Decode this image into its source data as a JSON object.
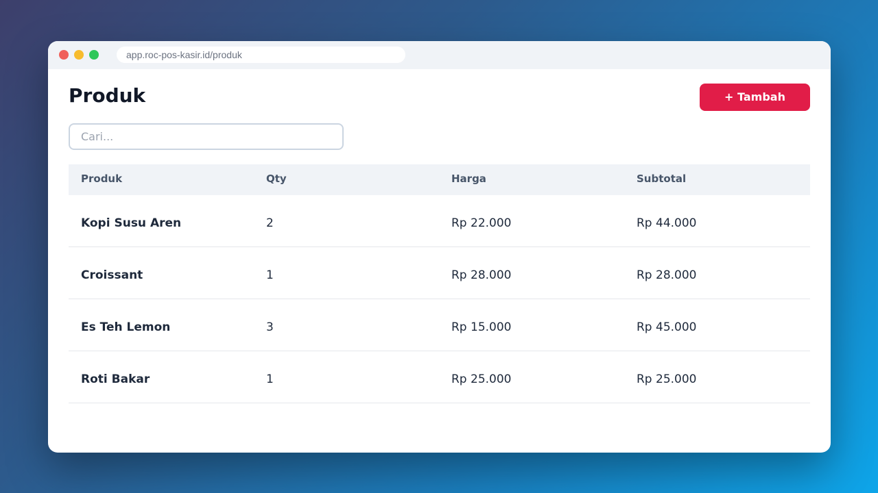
{
  "browser": {
    "url": "app.roc-pos-kasir.id/produk"
  },
  "page": {
    "title": "Produk",
    "add_button_label": "+ Tambah"
  },
  "search": {
    "placeholder": "Cari...",
    "value": ""
  },
  "table": {
    "columns": [
      "Produk",
      "Qty",
      "Harga",
      "Subtotal"
    ],
    "rows": [
      {
        "produk": "Kopi Susu Aren",
        "qty": "2",
        "harga": "Rp 22.000",
        "subtotal": "Rp 44.000"
      },
      {
        "produk": "Croissant",
        "qty": "1",
        "harga": "Rp 28.000",
        "subtotal": "Rp 28.000"
      },
      {
        "produk": "Es Teh Lemon",
        "qty": "3",
        "harga": "Rp 15.000",
        "subtotal": "Rp 45.000"
      },
      {
        "produk": "Roti Bakar",
        "qty": "1",
        "harga": "Rp 25.000",
        "subtotal": "Rp 25.000"
      }
    ]
  },
  "colors": {
    "accent": "#e11d48",
    "header_bg": "#f0f3f7",
    "title_text": "#111827"
  }
}
